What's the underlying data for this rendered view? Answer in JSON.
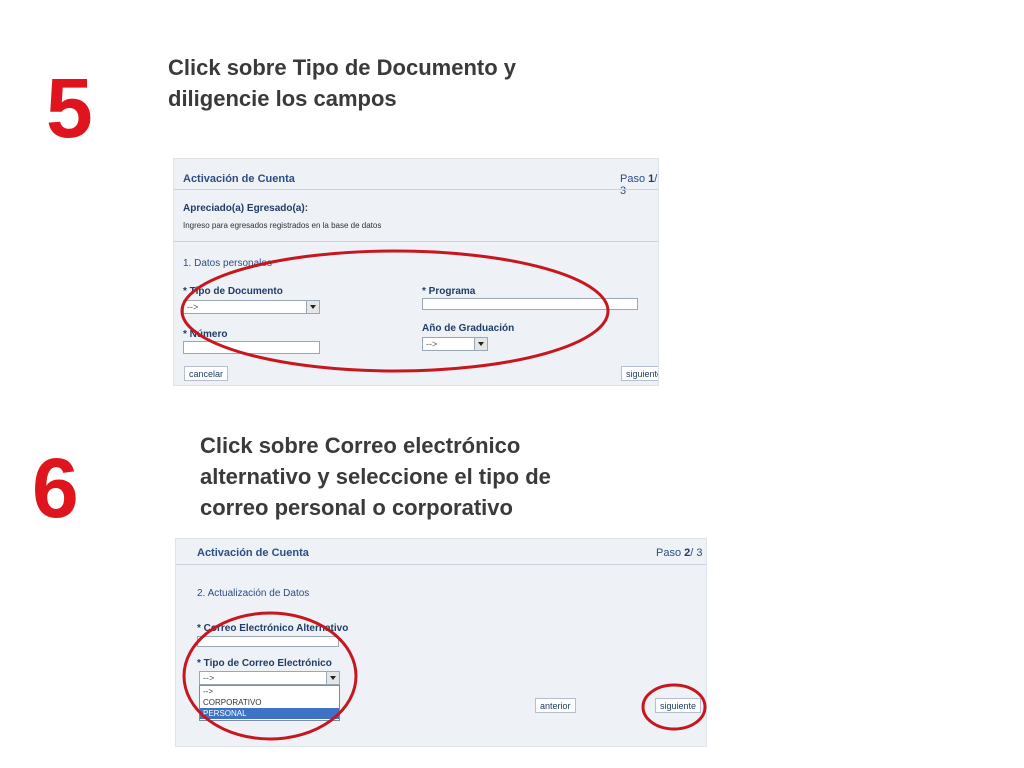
{
  "step5": {
    "number": "5",
    "caption_lines": [
      "Click sobre Tipo de Documento y",
      "diligencie los  campos"
    ],
    "panel": {
      "title": "Activación de Cuenta",
      "step_prefix": "Paso ",
      "step_current": "1",
      "step_total": "/ 3",
      "greeting": "Apreciado(a) Egresado(a):",
      "description": "Ingreso para egresados registrados en la base de datos",
      "section": "1. Datos personales",
      "tipo_documento_label": "* Tipo de Documento",
      "tipo_documento_value": "-->",
      "numero_label": "* Número",
      "programa_label": "* Programa",
      "anio_label": "Año de Graduación",
      "anio_value": "-->",
      "cancel_label": "cancelar",
      "next_label": "siguiente"
    }
  },
  "step6": {
    "number": "6",
    "caption_lines": [
      "Click sobre Correo electrónico",
      "alternativo y seleccione el tipo de",
      "correo personal o corporativo"
    ],
    "panel": {
      "title": "Activación de Cuenta",
      "step_prefix": "Paso ",
      "step_current": "2",
      "step_total": "/ 3",
      "section": "2. Actualización de Datos",
      "correo_alt_label": "* Correo Electrónico Alternativo",
      "tipo_correo_label": "* Tipo de Correo Electrónico",
      "tipo_correo_value": "-->",
      "options": [
        "-->",
        "CORPORATIVO",
        "PERSONAL"
      ],
      "selected_option": "PERSONAL",
      "prev_label": "anterior",
      "next_label": "siguiente"
    }
  },
  "colors": {
    "step_number": "#e0141c",
    "highlight_ellipse": "#c8161e",
    "selected_option": "#3d72c4"
  }
}
